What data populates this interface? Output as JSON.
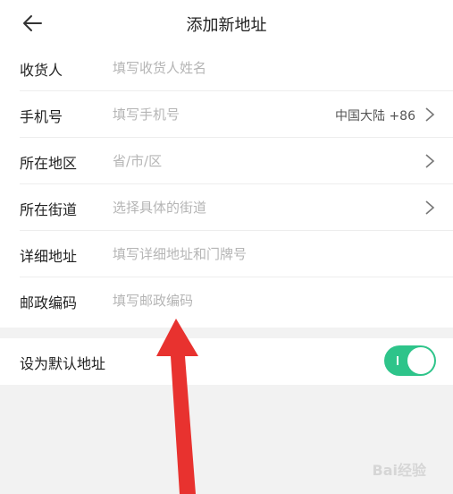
{
  "header": {
    "title": "添加新地址"
  },
  "form": {
    "rows": [
      {
        "label": "收货人",
        "placeholder": "填写收货人姓名"
      },
      {
        "label": "手机号",
        "placeholder": "填写手机号",
        "region": "中国大陆 +86"
      },
      {
        "label": "所在地区",
        "placeholder": "省/市/区"
      },
      {
        "label": "所在街道",
        "placeholder": "选择具体的街道"
      },
      {
        "label": "详细地址",
        "placeholder": "填写详细地址和门牌号"
      },
      {
        "label": "邮政编码",
        "placeholder": "填写邮政编码"
      }
    ]
  },
  "default_address": {
    "label": "设为默认地址",
    "enabled": true
  },
  "colors": {
    "accent": "#2ec48a",
    "annotation_arrow": "#e8322f"
  },
  "watermark": {
    "text": "Bai经验"
  }
}
